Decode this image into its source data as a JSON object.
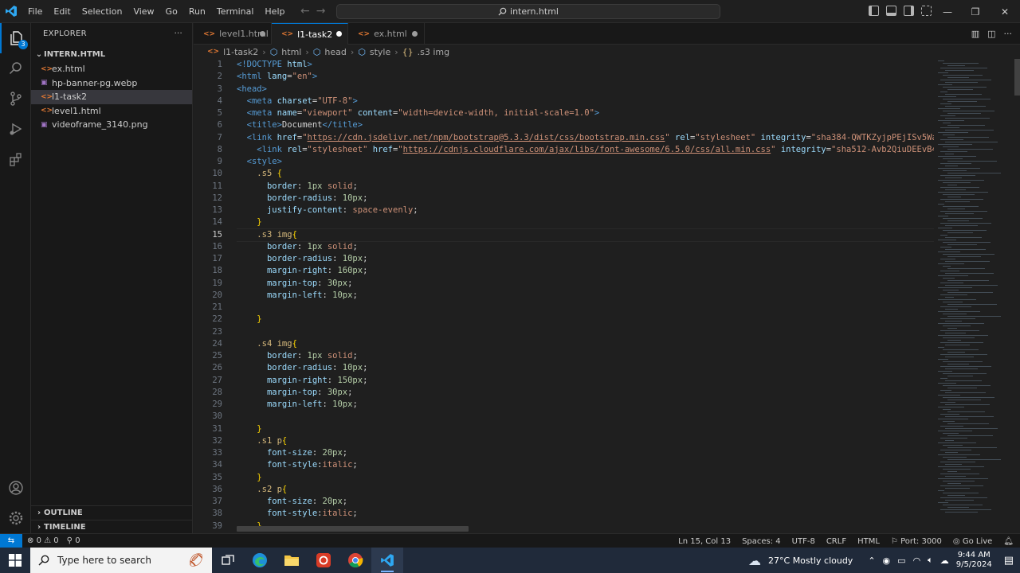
{
  "titlebar": {
    "menus": [
      "File",
      "Edit",
      "Selection",
      "View",
      "Go",
      "Run",
      "Terminal",
      "Help"
    ],
    "search_text": "intern.html",
    "icons": [
      "vscode-logo",
      "back-arrow",
      "forward-arrow",
      "search-icon",
      "toggle-primary-sidebar",
      "toggle-panel",
      "toggle-secondary-sidebar",
      "customize-layout",
      "minimize",
      "maximize",
      "close"
    ]
  },
  "activitybar": {
    "items": [
      "explorer-icon",
      "search-icon",
      "source-control-icon",
      "run-debug-icon",
      "extensions-icon",
      "account-icon",
      "manage-gear-icon"
    ],
    "explorer_badge": "3"
  },
  "sidebar": {
    "title": "EXPLORER",
    "more": "···",
    "folder": "INTERN.HTML",
    "files": [
      {
        "name": "ex.html",
        "type": "html"
      },
      {
        "name": "hp-banner-pg.webp",
        "type": "image"
      },
      {
        "name": "l1-task2",
        "type": "html",
        "selected": true
      },
      {
        "name": "level1.html",
        "type": "html"
      },
      {
        "name": "videoframe_3140.png",
        "type": "image"
      }
    ],
    "outline": "OUTLINE",
    "timeline": "TIMELINE"
  },
  "tabs": [
    {
      "label": "level1.html",
      "active": false,
      "dirty": true
    },
    {
      "label": "l1-task2",
      "active": true,
      "dirty": true
    },
    {
      "label": "ex.html",
      "active": false,
      "dirty": true
    }
  ],
  "breadcrumb": [
    "l1-task2",
    "html",
    "head",
    "style",
    ".s3 img"
  ],
  "editor": {
    "current_line": 15,
    "line_numbers": [
      "1",
      "2",
      "3",
      "4",
      "5",
      "6",
      "7",
      "8",
      "9",
      "10",
      "11",
      "12",
      "13",
      "14",
      "15",
      "16",
      "17",
      "18",
      "19",
      "20",
      "21",
      "22",
      "23",
      "24",
      "25",
      "26",
      "27",
      "28",
      "29",
      "30",
      "31",
      "32",
      "33",
      "34",
      "35",
      "36",
      "37",
      "38",
      "39"
    ]
  },
  "statusbar": {
    "remote": "⇆",
    "errors": "0",
    "warnings": "0",
    "ports_count": "0",
    "position": "Ln 15, Col 13",
    "spaces": "Spaces: 4",
    "encoding": "UTF-8",
    "eol": "CRLF",
    "language": "HTML",
    "port": "Port: 3000",
    "golive": "Go Live"
  },
  "taskbar": {
    "search_placeholder": "Type here to search",
    "weather": "27°C  Mostly cloudy",
    "time": "9:44 AM",
    "date": "9/5/2024"
  },
  "colors": {
    "accent": "#0078d4",
    "editor_bg": "#1f1f1f",
    "sidebar_bg": "#181818",
    "selected_row": "#37373d"
  }
}
